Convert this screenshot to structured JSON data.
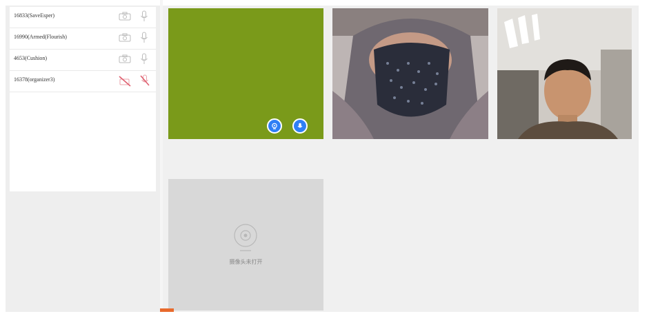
{
  "participants": [
    {
      "name": "16833(SaveEsper)",
      "camera": "off-outline",
      "mic": "off-outline"
    },
    {
      "name": "16990(Armed(Flourish)",
      "camera": "off-outline",
      "mic": "off-outline"
    },
    {
      "name": "4653(Cushion)",
      "camera": "off-outline",
      "mic": "off-outline"
    },
    {
      "name": "16378(organizer3)",
      "camera": "disabled",
      "mic": "disabled"
    }
  ],
  "video_placeholder": {
    "text": "摄像头未打开",
    "icon": "webcam-icon"
  },
  "colors": {
    "accent": "#2f7ff5",
    "disabled": "#e06070",
    "tile_green": "#7a9a1a",
    "orange": "#e86a2c"
  }
}
